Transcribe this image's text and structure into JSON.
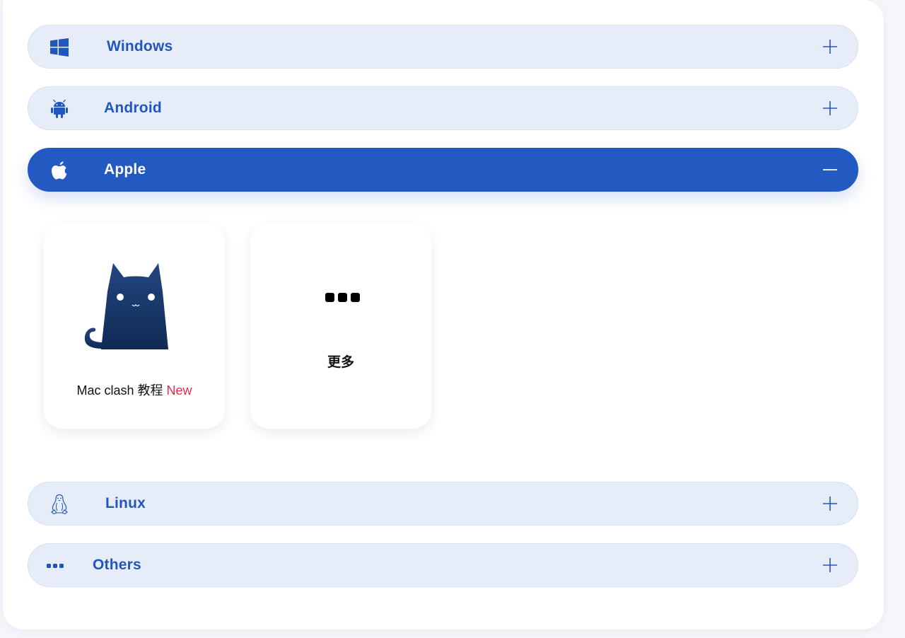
{
  "sections": {
    "windows": {
      "label": "Windows",
      "icon": "windows-icon",
      "toggle": "plus-icon"
    },
    "android": {
      "label": "Android",
      "icon": "android-icon",
      "toggle": "plus-icon"
    },
    "apple": {
      "label": "Apple",
      "icon": "apple-icon",
      "toggle": "minus-icon",
      "expanded": true
    },
    "linux": {
      "label": "Linux",
      "icon": "linux-penguin-icon",
      "toggle": "plus-icon"
    },
    "others": {
      "label": "Others",
      "icon": "dots-icon",
      "toggle": "plus-icon"
    }
  },
  "apple_cards": [
    {
      "title": "Mac clash 教程",
      "badge": "New",
      "icon": "clash-cat-icon"
    },
    {
      "title": "更多",
      "icon": "more-dots-icon"
    }
  ],
  "colors": {
    "accent": "#235ac2",
    "row_bg": "#e6edf8",
    "badge_new": "#e8294b"
  }
}
